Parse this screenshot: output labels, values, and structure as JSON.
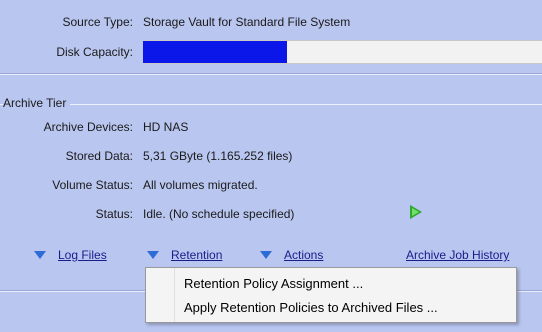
{
  "storage": {
    "source_type_label": "Source Type:",
    "source_type_value": "Storage Vault for Standard File System",
    "disk_capacity_label": "Disk Capacity:",
    "disk_capacity_fill": 0.36,
    "disk_capacity_fill_color": "#0b16e8"
  },
  "archive": {
    "group_title": "Archive Tier",
    "devices_label": "Archive Devices:",
    "devices_value": "HD NAS",
    "stored_label": "Stored Data:",
    "stored_value": "5,31 GByte (1.165.252 files)",
    "volume_label": "Volume Status:",
    "volume_value": "All volumes migrated.",
    "status_label": "Status:",
    "status_value": "Idle. (No schedule specified)",
    "start_icon": "play-icon"
  },
  "links": {
    "log_files": "Log Files",
    "retention": "Retention",
    "actions": "Actions",
    "archive_job_history": "Archive Job History"
  },
  "menu": {
    "items": [
      "Retention Policy Assignment ...",
      "Apply Retention Policies to Archived Files ..."
    ]
  },
  "colors": {
    "background": "#b9c6f0",
    "link": "#1c1c8a",
    "triangle": "#2d6bd6",
    "play": "#2fa82f"
  }
}
